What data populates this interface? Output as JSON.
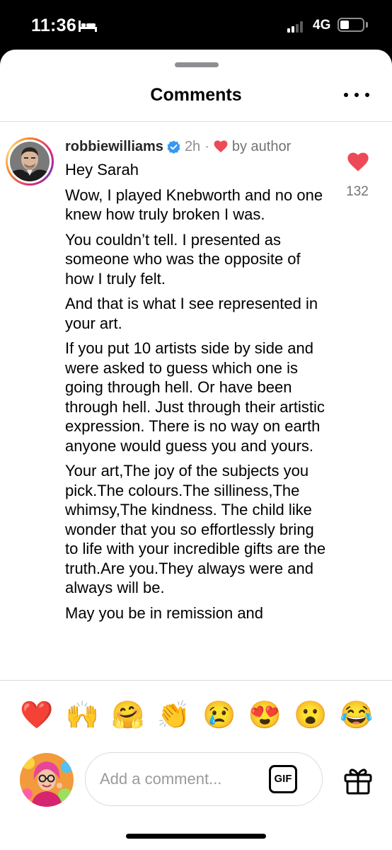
{
  "status_bar": {
    "time": "11:36",
    "network": "4G"
  },
  "sheet": {
    "title": "Comments"
  },
  "comment": {
    "username": "robbiewilliams",
    "time_ago": "2h",
    "separator": "·",
    "author_like": "by author",
    "paragraphs": [
      "Hey Sarah",
      "Wow, I played Knebworth and no one knew how truly broken I was.",
      "You couldn’t tell. I presented as someone who was the opposite of how I truly felt.",
      "And that is what I see represented in your art.",
      "If you put 10 artists side by side and were asked to guess which one is going through hell. Or have been through hell. Just through their artistic expression. There is no way on earth anyone would guess you and yours.",
      "Your art,The joy of the subjects you pick.The colours.The silliness,The whimsy,The kindness. The child like wonder that you so effortlessly bring to life with your incredible gifts are the truth.Are you.They always were and always will be.",
      "May you be in remission and"
    ],
    "like_count": "132",
    "accent_color": "#ed4956",
    "verified_color": "#3897f0"
  },
  "reactions": [
    "❤️",
    "🙌",
    "🤗",
    "👏",
    "😢",
    "😍",
    "😮",
    "😂"
  ],
  "composer": {
    "placeholder": "Add a comment...",
    "gif_label": "GIF"
  }
}
